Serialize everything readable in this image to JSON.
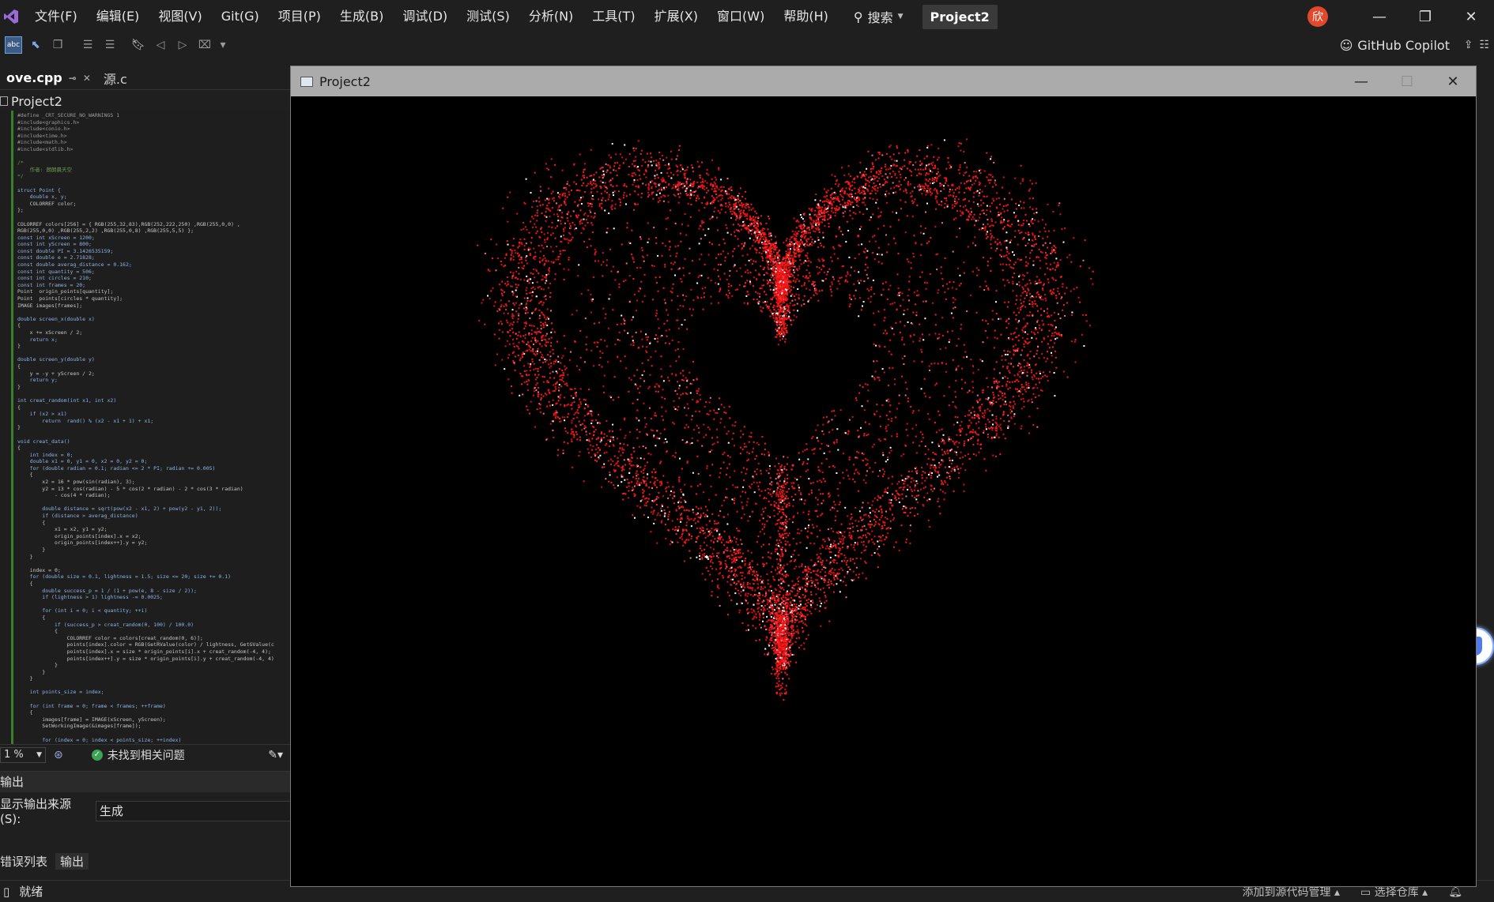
{
  "menu": {
    "items": [
      "文件(F)",
      "编辑(E)",
      "视图(V)",
      "Git(G)",
      "项目(P)",
      "生成(B)",
      "调试(D)",
      "测试(S)",
      "分析(N)",
      "工具(T)",
      "扩展(X)",
      "窗口(W)",
      "帮助(H)"
    ],
    "search_label": "搜索",
    "project_title": "Project2",
    "user_initial": "欣"
  },
  "toolbar": {
    "copilot_label": "GitHub Copilot"
  },
  "editor": {
    "tabs": [
      {
        "label": "ove.cpp",
        "active": true
      },
      {
        "label": "源.c",
        "active": false
      }
    ],
    "nav_project": "Project2",
    "zoom": "1 %",
    "issues_text": "未找到相关问题",
    "code_lines": [
      "#define _CRT_SECURE_NO_WARNINGS 1",
      "#include<graphics.h>",
      "#include<conio.h>",
      "#include<time.h>",
      "#include<math.h>",
      "#include<stdlib.h>",
      "",
      "/*",
      "    作者: 朗朗晨天空",
      "*/",
      "",
      "struct Point {",
      "    double x, y;",
      "    COLORREF color;",
      "};",
      "",
      "COLORREF colors[256] = { RGB(255,32,83),RGB(252,222,250) ,RGB(255,0,0) ,",
      "RGB(255,0,0) ,RGB(255,2,2) ,RGB(255,0,8) ,RGB(255,5,5) };",
      "const int xScreen = 1200;",
      "const int yScreen = 800;",
      "const double PI = 3.1426535159;",
      "const double e = 2.71828;",
      "const double averag_distance = 0.162;",
      "const int quantity = 506;",
      "const int circles = 210;",
      "const int frames = 20;",
      "Point  origin_points[quantity];",
      "Point  points[circles * quantity];",
      "IMAGE images[frames];",
      "",
      "double screen_x(double x)",
      "{",
      "    x += xScreen / 2;",
      "    return x;",
      "}",
      "",
      "double screen_y(double y)",
      "{",
      "    y = -y + yScreen / 2;",
      "    return y;",
      "}",
      "",
      "int creat_random(int x1, int x2)",
      "{",
      "    if (x2 > x1)",
      "        return  rand() % (x2 - x1 + 1) + x1;",
      "}",
      "",
      "void creat_data()",
      "{",
      "    int index = 0;",
      "    double x1 = 0, y1 = 0, x2 = 0, y2 = 0;",
      "    for (double radian = 0.1; radian <= 2 * PI; radian += 0.005)",
      "    {",
      "        x2 = 16 * pow(sin(radian), 3);",
      "        y2 = 13 * cos(radian) - 5 * cos(2 * radian) - 2 * cos(3 * radian)",
      "            - cos(4 * radian);",
      "",
      "        double distance = sqrt(pow(x2 - x1, 2) + pow(y2 - y1, 2));",
      "        if (distance > averag_distance)",
      "        {",
      "            x1 = x2, y1 = y2;",
      "            origin_points[index].x = x2;",
      "            origin_points[index++].y = y2;",
      "        }",
      "    }",
      "",
      "    index = 0;",
      "    for (double size = 0.1, lightness = 1.5; size <= 20; size += 0.1)",
      "    {",
      "        double success_p = 1 / (1 + pow(e, 8 - size / 2));",
      "        if (lightness > 1) lightness -= 0.0025;",
      "",
      "        for (int i = 0; i < quantity; ++i)",
      "        {",
      "            if (success_p > creat_random(0, 100) / 100.0)",
      "            {",
      "                COLORREF color = colors[creat_random(0, 6)];",
      "                points[index].color = RGB(GetRValue(color) / lightness, GetGValue(c",
      "                points[index].x = size * origin_points[i].x + creat_random(-4, 4);",
      "                points[index++].y = size * origin_points[i].y + creat_random(-4, 4)",
      "            }",
      "        }",
      "    }",
      "",
      "    int points_size = index;",
      "",
      "    for (int frame = 0; frame < frames; ++frame)",
      "    {",
      "        images[frame] = IMAGE(xScreen, yScreen);",
      "        SetWorkingImage(&images[frame]);",
      "",
      "        for (index = 0; index < points_size; ++index)"
    ]
  },
  "output": {
    "title": "输出",
    "source_label": "显示输出来源(S):",
    "source_value": "生成"
  },
  "bottom_tabs": [
    "错误列表",
    "输出"
  ],
  "status": {
    "ready": "就绪",
    "add_to_source": "添加到源代码管理",
    "select_repo": "选择仓库"
  },
  "graphics_window": {
    "title": "Project2"
  },
  "colors": {
    "heart_red": "#ff1a1a",
    "heart_white": "#ffffff",
    "heart_pink": "#ff6a8a"
  }
}
